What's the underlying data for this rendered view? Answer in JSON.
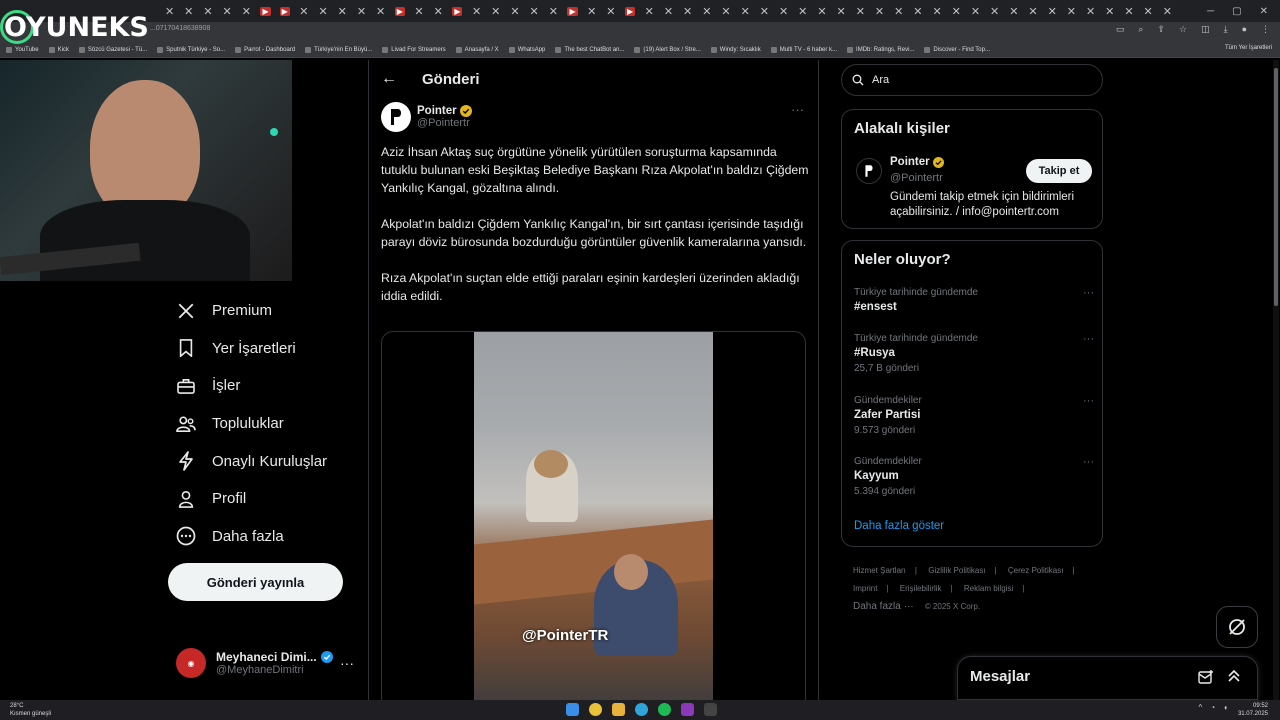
{
  "browser": {
    "url": "...07170418638908",
    "bookmarks": [
      "YouTube",
      "Kick",
      "Sözcü Gazetesi - Tü...",
      "Sputnik Türkiye - So...",
      "Parrot - Dashboard",
      "Türkiye'nin En Büyü...",
      "Livad For Streamers",
      "Anasayfa / X",
      "WhatsApp",
      "The best ChatBot an...",
      "(19) Alert Box / Stre...",
      "Windy: Sıcaklık",
      "Multi TV - 6 haber k...",
      "IMDb: Ratings, Revi...",
      "Discover - Find Top..."
    ],
    "all_bookmarks": "Tüm Yer İşaretleri"
  },
  "overlay": {
    "brand": "OYUNEKS"
  },
  "nav": {
    "items": [
      {
        "label": "Premium",
        "icon": "x-logo-icon"
      },
      {
        "label": "Yer İşaretleri",
        "icon": "bookmark-icon"
      },
      {
        "label": "İşler",
        "icon": "briefcase-icon"
      },
      {
        "label": "Topluluklar",
        "icon": "people-icon"
      },
      {
        "label": "Onaylı Kuruluşlar",
        "icon": "lightning-icon"
      },
      {
        "label": "Profil",
        "icon": "person-icon"
      },
      {
        "label": "Daha fazla",
        "icon": "more-circle-icon"
      }
    ],
    "post_button": "Gönderi yayınla"
  },
  "account": {
    "name": "Meyhaneci Dimi...",
    "handle": "@MeyhaneDimitri"
  },
  "main": {
    "title": "Gönderi",
    "author_name": "Pointer",
    "author_handle": "@Pointertr",
    "paragraphs": [
      "Aziz İhsan Aktaş suç örgütüne yönelik yürütülen soruşturma kapsamında tutuklu bulunan eski Beşiktaş Belediye Başkanı Rıza Akpolat'ın baldızı Çiğdem Yankılıç Kangal, gözaltına alındı.",
      "Akpolat'ın baldızı Çiğdem Yankılıç Kangal'ın, bir sırt çantası içerisinde taşıdığı parayı döviz bürosunda bozdurduğu görüntüler güvenlik kameralarına yansıdı.",
      "Rıza Akpolat'ın suçtan elde ettiği paraları eşinin kardeşleri üzerinden akladığı iddia edildi."
    ],
    "media_watermark": "@PointerTR"
  },
  "sidebar": {
    "search_placeholder": "Ara",
    "related": {
      "title": "Alakalı kişiler",
      "name": "Pointer",
      "handle": "@Pointertr",
      "bio": "Gündemi takip etmek için bildirimleri açabilirsiniz. / info@pointertr.com",
      "follow_label": "Takip et"
    },
    "trends": {
      "title": "Neler oluyor?",
      "items": [
        {
          "context": "Türkiye tarihinde gündemde",
          "name": "#ensest",
          "count": ""
        },
        {
          "context": "Türkiye tarihinde gündemde",
          "name": "#Rusya",
          "count": "25,7 B gönderi"
        },
        {
          "context": "Gündemdekiler",
          "name": "Zafer Partisi",
          "count": "9.573 gönderi"
        },
        {
          "context": "Gündemdekiler",
          "name": "Kayyum",
          "count": "5.394 gönderi"
        }
      ],
      "show_more": "Daha fazla göster"
    },
    "footer": [
      "Hizmet Şartları",
      "Gizlilik Politikası",
      "Çerez Politikası",
      "Imprint",
      "Erişilebilirlik",
      "Reklam bilgisi",
      "Daha fazla ···",
      "© 2025 X Corp."
    ]
  },
  "messages": {
    "title": "Mesajlar"
  },
  "taskbar": {
    "temp": "28°C",
    "weather": "Kısmen güneşli",
    "time": "09:52",
    "date": "31.07.2025"
  },
  "colors": {
    "accent": "#1d9bf0",
    "verified": "#e2b719",
    "bg": "#000000"
  }
}
